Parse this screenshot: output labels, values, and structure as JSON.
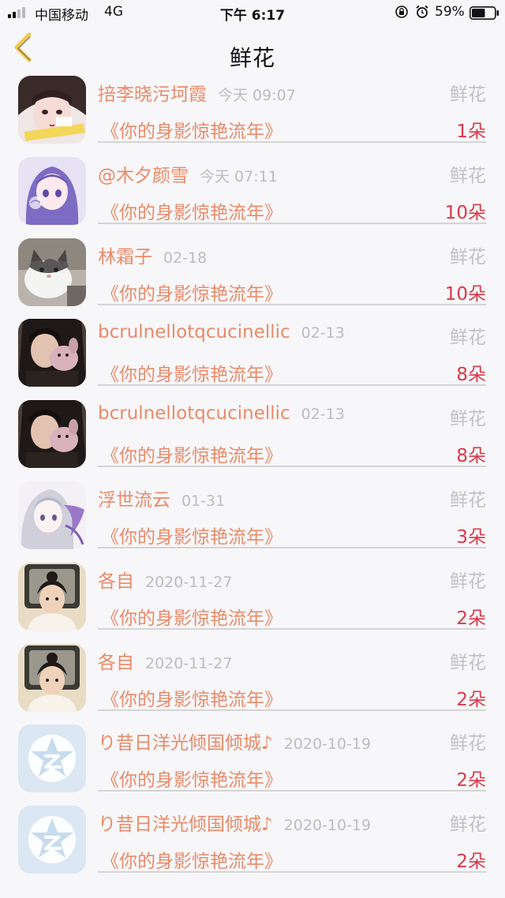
{
  "status_bar": {
    "carrier": "中国移动",
    "network": "4G",
    "time": "下午 6:17",
    "battery_percent": "59%",
    "battery_level": 0.59
  },
  "nav": {
    "back_icon": "chevron-left-icon",
    "title": "鲜花",
    "accent_color": "#f2c84b"
  },
  "colors": {
    "name": "#e88b6a",
    "count": "#d9394b",
    "muted": "#c2c2c2"
  },
  "records": [
    {
      "name": "掊李晓污坷霞",
      "date": "今天 09:07",
      "type": "鲜花",
      "work": "《你的身影惊艳流年》",
      "count": "1朵",
      "avatar": "avatar-girl-bandage"
    },
    {
      "name": "@木夕颜雪",
      "date": "今天 07:11",
      "type": "鲜花",
      "work": "《你的身影惊艳流年》",
      "count": "10朵",
      "avatar": "avatar-anime-purple"
    },
    {
      "name": "林霜子",
      "date": "02-18",
      "type": "鲜花",
      "work": "《你的身影惊艳流年》",
      "count": "10朵",
      "avatar": "avatar-cat"
    },
    {
      "name": "bcrulnellotqcucinellic",
      "date": "02-13",
      "type": "鲜花",
      "work": "《你的身影惊艳流年》",
      "count": "8朵",
      "avatar": "avatar-girl-plush"
    },
    {
      "name": "bcrulnellotqcucinellic",
      "date": "02-13",
      "type": "鲜花",
      "work": "《你的身影惊艳流年》",
      "count": "8朵",
      "avatar": "avatar-girl-plush"
    },
    {
      "name": "浮世流云",
      "date": "01-31",
      "type": "鲜花",
      "work": "《你的身影惊艳流年》",
      "count": "3朵",
      "avatar": "avatar-anime-white"
    },
    {
      "name": "各自",
      "date": "2020-11-27",
      "type": "鲜花",
      "work": "《你的身影惊艳流年》",
      "count": "2朵",
      "avatar": "avatar-girl-tv"
    },
    {
      "name": "各自",
      "date": "2020-11-27",
      "type": "鲜花",
      "work": "《你的身影惊艳流年》",
      "count": "2朵",
      "avatar": "avatar-girl-tv"
    },
    {
      "name": "り昔日洋光倾国倾城♪",
      "date": "2020-10-19",
      "type": "鲜花",
      "work": "《你的身影惊艳流年》",
      "count": "2朵",
      "avatar": "avatar-qq-default"
    },
    {
      "name": "り昔日洋光倾国倾城♪",
      "date": "2020-10-19",
      "type": "鲜花",
      "work": "《你的身影惊艳流年》",
      "count": "2朵",
      "avatar": "avatar-qq-default"
    }
  ]
}
